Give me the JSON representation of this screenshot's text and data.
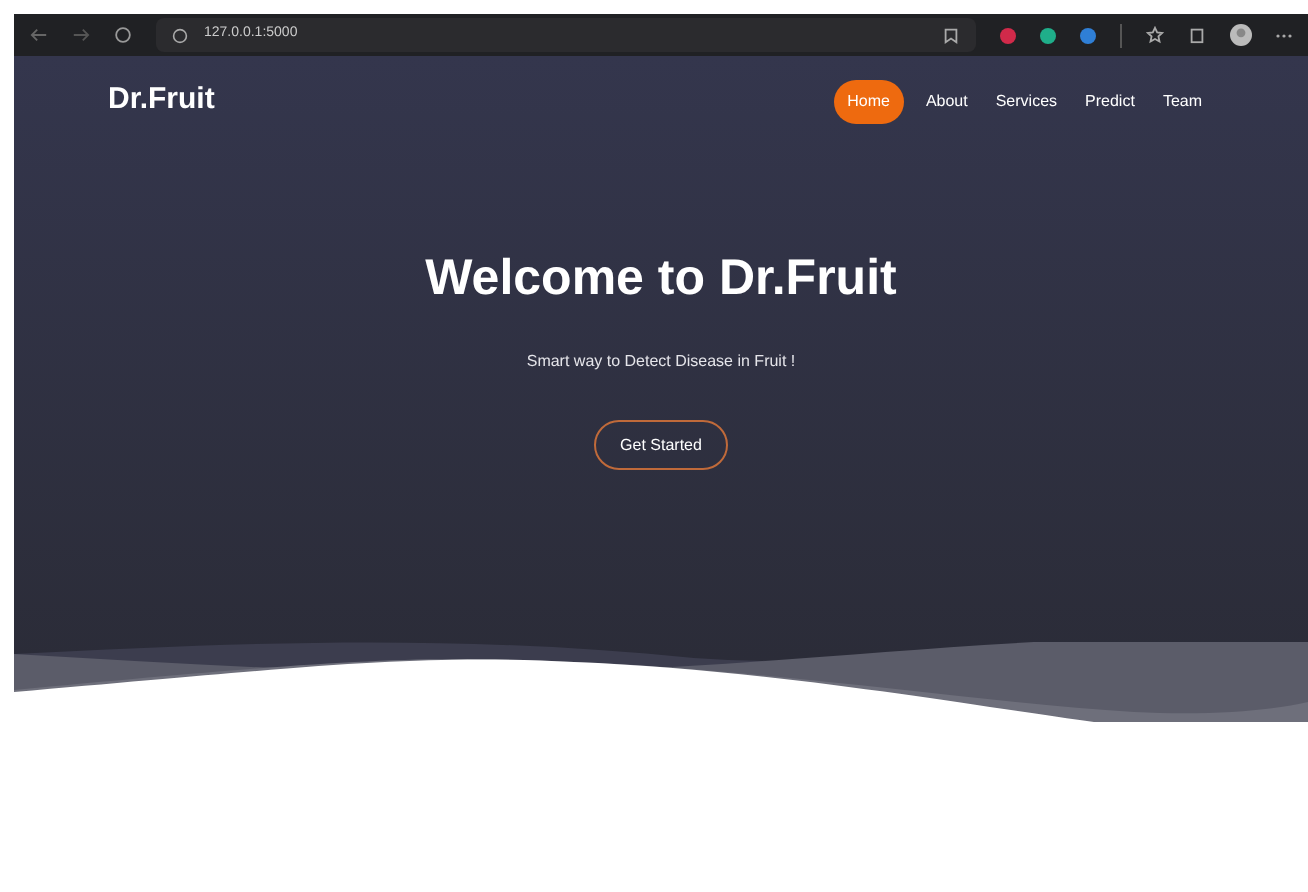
{
  "browser": {
    "url": "127.0.0.1:5000",
    "extensions": [
      {
        "color": "#d12a4a"
      },
      {
        "color": "#1fae8a"
      },
      {
        "color": "#2f7fd6"
      }
    ]
  },
  "nav": {
    "brand": "Dr.Fruit",
    "items": [
      {
        "label": "Home",
        "selected": true
      },
      {
        "label": "About",
        "selected": false
      },
      {
        "label": "Services",
        "selected": false
      },
      {
        "label": "Predict",
        "selected": false
      },
      {
        "label": "Team",
        "selected": false
      }
    ]
  },
  "hero": {
    "title": "Welcome to Dr.Fruit",
    "subtitle": "Smart way to Detect Disease in Fruit !",
    "button": "Get Started"
  }
}
